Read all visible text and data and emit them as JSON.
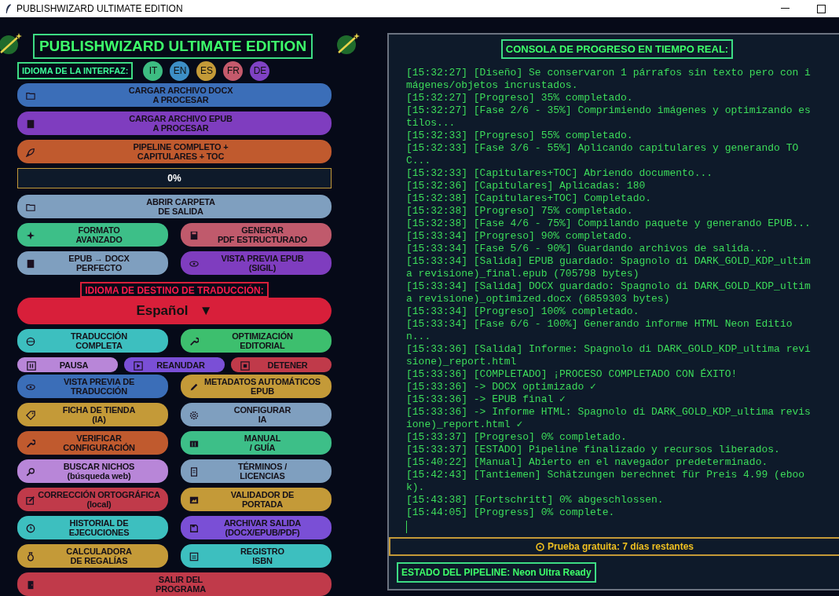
{
  "window": {
    "title": "PUBLISHWIZARD ULTIMATE EDITION"
  },
  "header": {
    "title": "PUBLISHWIZARD ULTIMATE EDITION"
  },
  "interface_language": {
    "label": "IDIOMA DE LA INTERFAZ:",
    "languages": [
      {
        "code": "IT",
        "color": "#3dbd82"
      },
      {
        "code": "EN",
        "color": "#3d8fc6"
      },
      {
        "code": "ES",
        "color": "#c49a38"
      },
      {
        "code": "FR",
        "color": "#c55a6c"
      },
      {
        "code": "DE",
        "color": "#7f42c4"
      }
    ]
  },
  "left_rows": [
    {
      "kind": "full",
      "buttons": [
        {
          "label": "CARGAR ARCHIVO DOCX\nA PROCESAR",
          "color": "#3b6eb8"
        }
      ]
    },
    {
      "kind": "full",
      "buttons": [
        {
          "label": "CARGAR ARCHIVO EPUB\nA PROCESAR",
          "color": "#7f3dbf"
        }
      ]
    },
    {
      "kind": "full",
      "buttons": [
        {
          "label": "PIPELINE COMPLETO +\nCAPITULARES + TOC",
          "color": "#c05a2e"
        }
      ]
    },
    {
      "kind": "progress",
      "text": "0%",
      "level": 0
    },
    {
      "kind": "full",
      "buttons": [
        {
          "label": "ABRIR CARPETA\nDE SALIDA",
          "color": "#7f9fbf"
        }
      ]
    },
    {
      "kind": "pair",
      "buttons": [
        {
          "label": "FORMATO\nAVANZADO",
          "color": "#3dbf88"
        },
        {
          "label": "GENERAR\nPDF ESTRUCTURADO",
          "color": "#c05a6c"
        }
      ]
    },
    {
      "kind": "pair",
      "buttons": [
        {
          "label": "EPUB → DOCX\nPERFECTO",
          "color": "#7f9fbf"
        },
        {
          "label": "VISTA PREVIA EPUB\n(SIGIL)",
          "color": "#7f3dbf"
        }
      ]
    },
    {
      "kind": "heading",
      "text": "IDIOMA DE DESTINO DE TRADUCCIÓN:"
    },
    {
      "kind": "dropdown",
      "value": "Español",
      "arrow": "▼",
      "color": "#d81f3a"
    },
    {
      "kind": "pair",
      "buttons": [
        {
          "label": "TRADUCCIÓN\nCOMPLETA",
          "color": "#3dbfbf"
        },
        {
          "label": "OPTIMIZACIÓN\nEDITORIAL",
          "color": "#3dbf6e"
        }
      ]
    },
    {
      "kind": "trio",
      "buttons": [
        {
          "label": "PAUSA",
          "color": "#b886d8"
        },
        {
          "label": "REANUDAR",
          "color": "#7a4fd6"
        },
        {
          "label": "DETENER",
          "color": "#c03a4a"
        }
      ]
    },
    {
      "kind": "pair",
      "buttons": [
        {
          "label": "VISTA PREVIA DE\nTRADUCCIÓN",
          "color": "#3b6eb8"
        },
        {
          "label": "METADATOS AUTOMÁTICOS\nEPUB",
          "color": "#c49a38"
        }
      ]
    },
    {
      "kind": "pair",
      "buttons": [
        {
          "label": "FICHA DE TIENDA\n(IA)",
          "color": "#c49a38"
        },
        {
          "label": "CONFIGURAR\nIA",
          "color": "#7f9fbf"
        }
      ]
    },
    {
      "kind": "pair",
      "buttons": [
        {
          "label": "VERIFICAR\nCONFIGURACIÓN",
          "color": "#c05a2e"
        },
        {
          "label": "MANUAL\n/ GUÍA",
          "color": "#3dbf88"
        }
      ]
    },
    {
      "kind": "pair",
      "buttons": [
        {
          "label": "BUSCAR NICHOS\n(búsqueda web)",
          "color": "#b886d8"
        },
        {
          "label": "TÉRMINOS /\nLICENCIAS",
          "color": "#7f9fbf"
        }
      ]
    },
    {
      "kind": "pair",
      "buttons": [
        {
          "label": "CORRECCIÓN ORTOGRÁFICA\n(local)",
          "color": "#c03a4a"
        },
        {
          "label": "VALIDADOR DE\nPORTADA",
          "color": "#c49a38"
        }
      ]
    },
    {
      "kind": "pair",
      "buttons": [
        {
          "label": "HISTORIAL DE\nEJECUCIONES",
          "color": "#3dbfbf"
        },
        {
          "label": "ARCHIVAR SALIDA\n(DOCX/EPUB/PDF)",
          "color": "#7a4fd6"
        }
      ]
    },
    {
      "kind": "pair",
      "buttons": [
        {
          "label": "CALCULADORA\nDE REGALÍAS",
          "color": "#c49a38"
        },
        {
          "label": "REGISTRO\nISBN",
          "color": "#3dbfbf"
        }
      ]
    },
    {
      "kind": "full",
      "buttons": [
        {
          "label": "SALIR DEL\nPROGRAMA",
          "color": "#c03a4a"
        }
      ]
    }
  ],
  "console": {
    "title": "CONSOLA DE PROGRESO EN TIEMPO REAL:",
    "lines": [
      "[15:32:27] [Diseño] Se conservaron 1 párrafos sin texto pero con imágenes/objetos incrustados.",
      "[15:32:27] [Progreso] 35% completado.",
      "[15:32:27] [Fase 2/6 - 35%] Comprimiendo imágenes y optimizando estilos...",
      "[15:32:33] [Progreso] 55% completado.",
      "[15:32:33] [Fase 3/6 - 55%] Aplicando capitulares y generando TOC...",
      "[15:32:33] [Capitulares+TOC] Abriendo documento...",
      "[15:32:36] [Capitulares] Aplicadas: 180",
      "[15:32:38] [Capitulares+TOC] Completado.",
      "[15:32:38] [Progreso] 75% completado.",
      "[15:32:38] [Fase 4/6 - 75%] Compilando paquete y generando EPUB...",
      "[15:33:34] [Progreso] 90% completado.",
      "[15:33:34] [Fase 5/6 - 90%] Guardando archivos de salida...",
      "[15:33:34] [Salida] EPUB guardado: Spagnolo di DARK_GOLD_KDP_ultima revisione)_final.epub (705798 bytes)",
      "[15:33:34] [Salida] DOCX guardado: Spagnolo di DARK_GOLD_KDP_ultima revisione)_optimized.docx (6859303 bytes)",
      "[15:33:34] [Progreso] 100% completado.",
      "[15:33:34] [Fase 6/6 - 100%] Generando informe HTML Neon Edition...",
      "[15:33:36] [Salida] Informe: Spagnolo di DARK_GOLD_KDP_ultima revisione)_report.html",
      "[15:33:36] [COMPLETADO] ¡PROCESO COMPLETADO CON ÉXITO!",
      "[15:33:36] -> DOCX optimizado ✓",
      "[15:33:36] -> EPUB final ✓",
      "[15:33:36] -> Informe HTML: Spagnolo di DARK_GOLD_KDP_ultima revisione)_report.html ✓",
      "[15:33:37] [Progreso] 0% completado.",
      "[15:33:37] [ESTADO] Pipeline finalizado y recursos liberados.",
      "[15:40:22] [Manual] Abierto en el navegador predeterminado.",
      "[15:42:43] [Tantiemen] Schätzungen berechnet für Preis 4.99 (ebook).",
      "[15:43:38] [Fortschritt] 0% abgeschlossen.",
      "[15:44:05] [Progress] 0% complete."
    ]
  },
  "trial": {
    "text": "Prueba gratuita: 7 días restantes"
  },
  "status": {
    "text": "ESTADO DEL PIPELINE: Neon Ultra Ready"
  }
}
